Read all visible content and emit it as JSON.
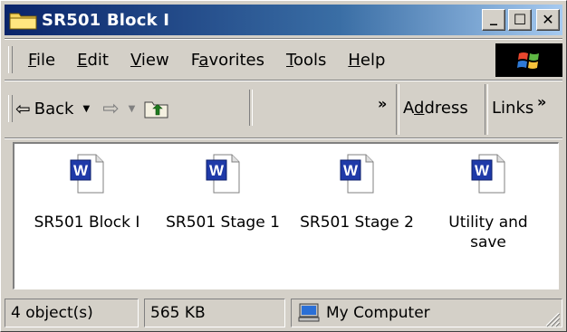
{
  "window": {
    "title": "SR501 Block I"
  },
  "caption_buttons": {
    "minimize": "_",
    "maximize": "☐",
    "close": "✕"
  },
  "menu": [
    {
      "label": "File",
      "accel": "F",
      "rest": "ile"
    },
    {
      "label": "Edit",
      "accel": "E",
      "rest": "dit"
    },
    {
      "label": "View",
      "accel": "V",
      "rest": "iew"
    },
    {
      "label": "Favorites",
      "pre": "F",
      "accel": "a",
      "rest": "vorites"
    },
    {
      "label": "Tools",
      "accel": "T",
      "rest": "ools"
    },
    {
      "label": "Help",
      "accel": "H",
      "rest": "elp"
    }
  ],
  "toolbar": {
    "back_label": "Back",
    "more_chevron": "»",
    "address_label": "Address",
    "address_pre": "A",
    "address_accel": "d",
    "address_rest": "dress",
    "links_label": "Links",
    "links_chevron": "»"
  },
  "files": [
    {
      "name": "SR501 Block I",
      "icon": "word-document-icon"
    },
    {
      "name": "SR501 Stage 1",
      "icon": "word-document-icon"
    },
    {
      "name": "SR501 Stage 2",
      "icon": "word-document-icon"
    },
    {
      "name": "Utility and save",
      "line1": "Utility and",
      "line2": "save",
      "icon": "word-document-icon"
    }
  ],
  "status": {
    "objects": "4 object(s)",
    "size": "565 KB",
    "zone": "My Computer"
  },
  "colors": {
    "title_start": "#0a246a",
    "title_end": "#a6caf0",
    "face": "#d4d0c8",
    "word_blue": "#1f3aa8"
  }
}
